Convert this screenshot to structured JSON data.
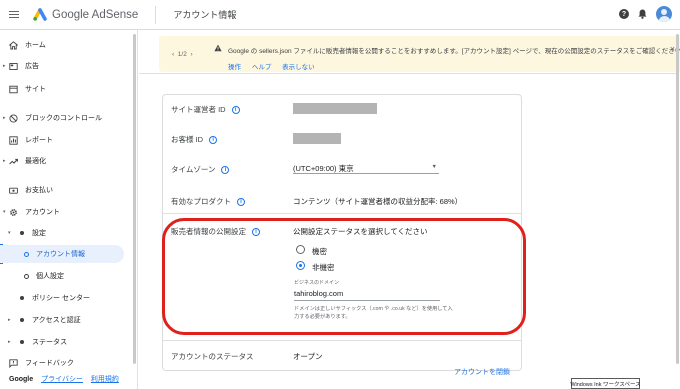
{
  "header": {
    "logo_text": "Google AdSense",
    "page_title": "アカウント情報",
    "help_glyph": "?"
  },
  "sidebar": {
    "items": [
      {
        "label": "ホーム",
        "icon": "home-icon"
      },
      {
        "label": "広告",
        "icon": "ads-icon"
      },
      {
        "label": "サイト",
        "icon": "sites-icon"
      },
      {
        "label": "ブロックのコントロール",
        "icon": "block-icon"
      },
      {
        "label": "レポート",
        "icon": "reports-icon"
      },
      {
        "label": "最適化",
        "icon": "trending-icon"
      },
      {
        "label": "お支払い",
        "icon": "payments-icon"
      },
      {
        "label": "アカウント",
        "icon": "gear-icon"
      },
      {
        "label": "設定"
      },
      {
        "label": "アカウント情報"
      },
      {
        "label": "個人設定"
      },
      {
        "label": "ポリシー センター"
      },
      {
        "label": "アクセスと認証"
      },
      {
        "label": "ステータス"
      },
      {
        "label": "フィードバック",
        "icon": "feedback-icon"
      }
    ],
    "footer": {
      "google": "Google",
      "privacy": "プライバシー",
      "terms": "利用規約"
    }
  },
  "banner": {
    "pager": "1/2",
    "prev_glyph": "‹",
    "next_glyph": "›",
    "message": "Google の sellers.json ファイルに販売者情報を公開することをおすすめします。[アカウント設定] ページで、現在の公開設定のステータスをご確認ください。",
    "links": [
      "操作",
      "ヘルプ",
      "表示しない"
    ],
    "close_glyph": "×"
  },
  "account": {
    "publisher_id_label": "サイト運営者 ID",
    "customer_id_label": "お客様 ID",
    "timezone_label": "タイムゾーン",
    "timezone_value": "(UTC+09:00) 東京",
    "products_label": "有効なプロダクト",
    "products_value": "コンテンツ（サイト運営者様の収益分配率: 68%）",
    "seller_info_label": "販売者情報の公開設定",
    "seller_info_prompt": "公開設定ステータスを選択してください",
    "radio_options": [
      "機密",
      "非機密"
    ],
    "selected_option": "非機密",
    "domain_caption": "ビジネスのドメイン",
    "domain_value": "tahiroblog.com",
    "domain_hint": "ドメインは正しいサフィックス（.com や .co.uk など）を使用して入力する必要があります。",
    "status_label": "アカウントのステータス",
    "status_value": "オープン",
    "close_account": "アカウントを閉鎖",
    "info_glyph": "i"
  },
  "taskbar": {
    "ink_label": "Windows Ink ワークスペース"
  },
  "colors": {
    "accent": "#1a73e8",
    "highlight_ring": "#e0201b",
    "banner_bg": "#fef7e0"
  }
}
